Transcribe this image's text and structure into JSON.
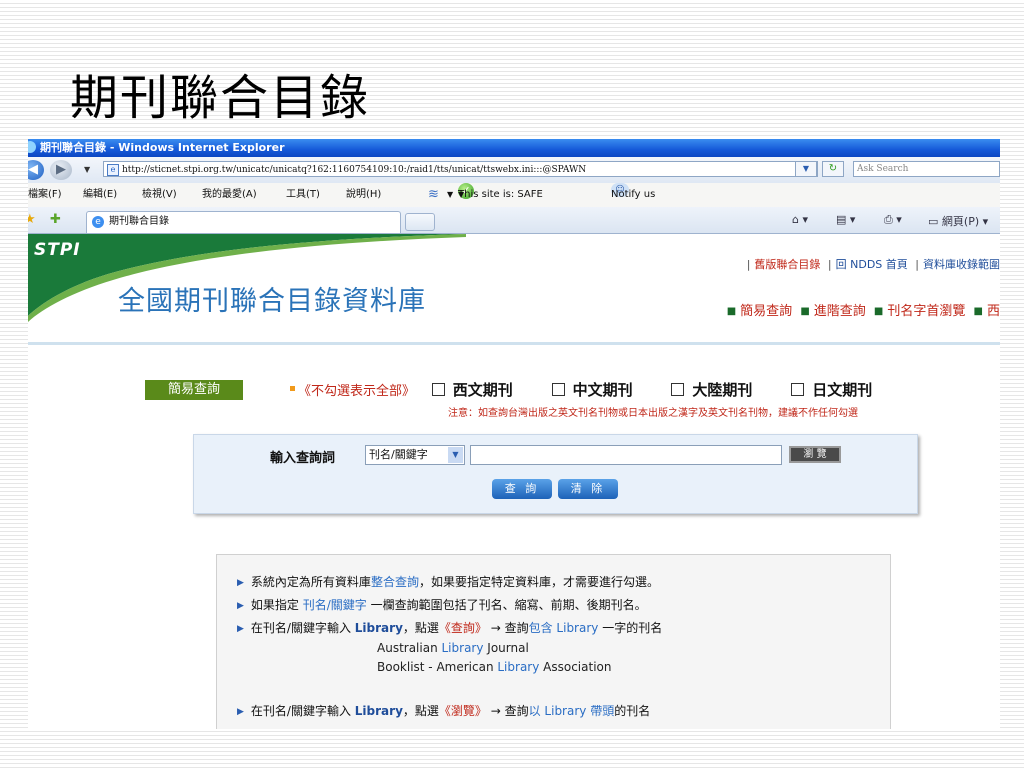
{
  "slide": {
    "title": "期刊聯合目錄"
  },
  "browser": {
    "window_title": "期刊聯合目錄 - Windows Internet Explorer",
    "url": "http://sticnet.stpi.org.tw/unicatc/unicatq?162:1160754109:10:/raid1/tts/unicat/ttswebx.ini:::@SPAWN",
    "search_placeholder": "Ask Search",
    "menu": [
      "檔案(F)",
      "編輯(E)",
      "檢視(V)",
      "我的最愛(A)",
      "工具(T)",
      "說明(H)"
    ],
    "safe_status": "This site is: SAFE",
    "notify": "Notify us",
    "tab_title": "期刊聯合目錄",
    "page_menu": "網頁(P)"
  },
  "site": {
    "logo": "STPI",
    "title": "全國期刊聯合目錄資料庫",
    "top_links": [
      "舊版聯合目錄",
      "回 NDDS 首頁",
      "資料庫收錄範圍"
    ],
    "nav_links": [
      "簡易查詢",
      "進階查詢",
      "刊名字首瀏覽",
      "西"
    ]
  },
  "search": {
    "mode_label": "簡易查詢",
    "untick_note": "《不勾選表示全部》",
    "options": [
      "西文期刊",
      "中文期刊",
      "大陸期刊",
      "日文期刊"
    ],
    "notice": "注意：如查詢台灣出版之英文刊名刊物或日本出版之漢字及英文刊名刊物，建議不作任何勾選",
    "query_label": "輸入查詢詞",
    "field_selected": "刊名/關鍵字",
    "browse_button": "瀏 覽",
    "query_button": "查 詢",
    "clear_button": "清 除"
  },
  "help": {
    "item1_a": "系統內定為所有資料庫",
    "item1_link": "整合查詢",
    "item1_b": "，如果要指定特定資料庫，才需要進行勾選。",
    "item2_a": "如果指定 ",
    "item2_link": "刊名/關鍵字",
    "item2_b": " 一欄查詢範圍包括了刊名、縮寫、前期、後期刊名。",
    "item3_a": "在刊名/關鍵字輸入 ",
    "item3_kw": "Library",
    "item3_b": "，點選",
    "item3_btn": "《查詢》",
    "item3_c": " → 查詢",
    "item3_link": "包含 Library",
    "item3_d": " 一字的刊名",
    "ex1_a": "Australian ",
    "ex1_kw": "Library",
    "ex1_b": " Journal",
    "ex2_a": "Booklist - American ",
    "ex2_kw": "Library",
    "ex2_b": " Association",
    "item4_a": "在刊名/關鍵字輸入 ",
    "item4_kw": "Library",
    "item4_b": "，點選",
    "item4_btn": "《瀏覽》",
    "item4_c": " → 查詢",
    "item4_link": "以 Library 帶頭",
    "item4_d": "的刊名"
  },
  "colors": {
    "accent_blue": "#2a73b8",
    "link_red": "#c0281a",
    "logo_green": "#1a7a3a"
  }
}
